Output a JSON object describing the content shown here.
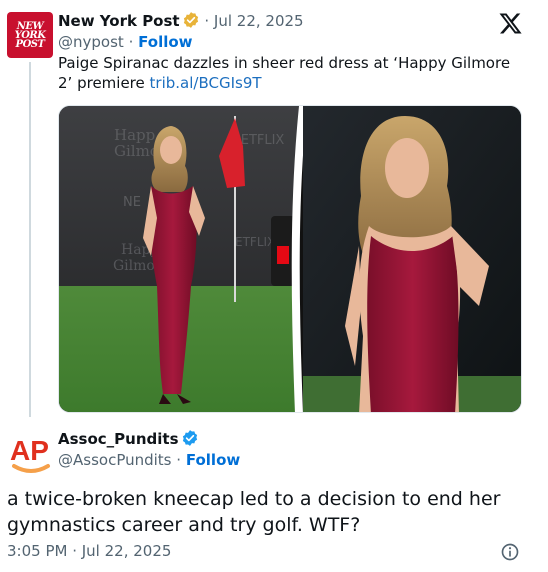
{
  "quoted_tweet": {
    "author_name": "New York Post",
    "logo_text": [
      "NEW",
      "YORK",
      "POST"
    ],
    "date": "· Jul 22, 2025",
    "handle": "@nypost",
    "separator": "·",
    "follow_label": "Follow",
    "text": "Paige Spiranac dazzles in sheer red dress at ‘Happy Gilmore 2’ premiere",
    "link": "trib.al/BCGIs9T",
    "backdrop_text": [
      "Happ",
      "Gilmo",
      "NETFLIX",
      "NE",
      "Happ",
      "Gilmo",
      "ETFLIX"
    ]
  },
  "reply_tweet": {
    "author_name": "Assoc_Pundits",
    "handle": "@AssocPundits",
    "separator": "·",
    "follow_label": "Follow",
    "logo_text": "AP",
    "text": "a twice-broken kneecap led to a decision to end her gymnastics career and try golf. WTF?",
    "timestamp": "3:05 PM · Jul 22, 2025"
  },
  "colors": {
    "nyp_red": "#c8102e",
    "follow_blue": "#006fd6",
    "verified_gold": "#e8b339",
    "verified_blue": "#1d9bf0",
    "ap_red": "#e0301e",
    "ap_orange": "#f5a04a"
  },
  "icons": [
    "x-logo-icon",
    "verified-gold-icon",
    "verified-blue-icon",
    "info-icon"
  ]
}
